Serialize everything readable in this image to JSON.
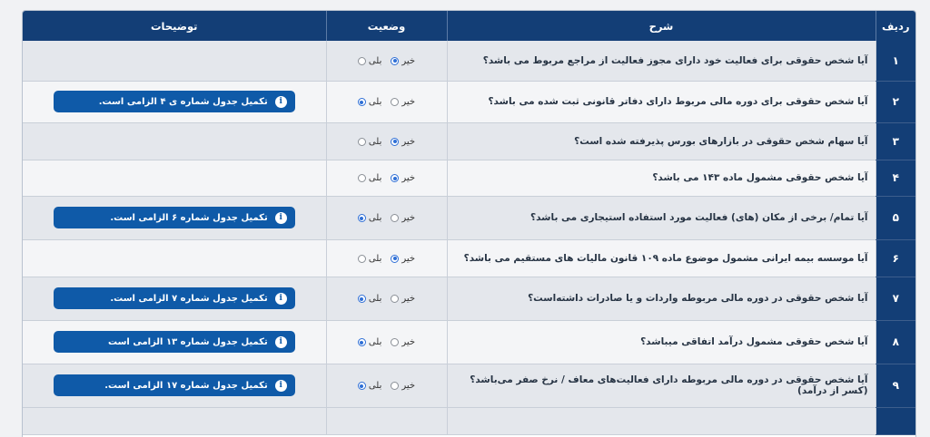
{
  "headers": {
    "num": "ردیف",
    "desc": "شرح",
    "status": "وضعیت",
    "notes": "توضیحات"
  },
  "options": {
    "no": "خیر",
    "yes": "بلی"
  },
  "rows": [
    {
      "num": "۱",
      "desc": "آیا شخص حقوقی برای فعالیت خود دارای مجوز فعالیت از مراجع مربوط می باشد؟",
      "selected": "no",
      "note": ""
    },
    {
      "num": "۲",
      "desc": "آیا شخص حقوقی برای دوره مالی مربوط دارای دفاتر قانونی ثبت شده می باشد؟",
      "selected": "yes",
      "note": "تکمیل جدول شماره ی ۴ الزامی است."
    },
    {
      "num": "۳",
      "desc": "آیا سهام شخص حقوقی در بازارهای بورس پذیرفته شده است؟",
      "selected": "no",
      "note": ""
    },
    {
      "num": "۴",
      "desc": "آیا شخص حقوقی مشمول ماده ۱۴۳ می باشد؟",
      "selected": "no",
      "note": ""
    },
    {
      "num": "۵",
      "desc": "آیا تمام/ برخی از مکان (های) فعالیت مورد استفاده استیجاری می باشد؟",
      "selected": "yes",
      "note": "تکمیل جدول شماره ۶ الزامی است."
    },
    {
      "num": "۶",
      "desc": "آیا موسسه بیمه ایرانی مشمول موضوع ماده ۱۰۹ قانون مالیات های مستقیم می باشد؟",
      "selected": "no",
      "note": ""
    },
    {
      "num": "۷",
      "desc": "آیا شخص حقوقی در دوره مالی مربوطه واردات و یا صادرات داشته‌است؟",
      "selected": "yes",
      "note": "تکمیل جدول شماره ۷ الزامی است."
    },
    {
      "num": "۸",
      "desc": "آیا شخص حقوقی مشمول درآمد اتفاقی میباشد؟",
      "selected": "yes",
      "note": "تکمیل جدول شماره ۱۳ الزامی است"
    },
    {
      "num": "۹",
      "desc": "آیا شخص حقوقی در دوره مالی مربوطه دارای فعالیت‌های معاف / نرخ صفر می‌باشد؟ (کسر از درآمد)",
      "selected": "yes",
      "note": "تکمیل جدول شماره ۱۷ الزامی است."
    }
  ]
}
